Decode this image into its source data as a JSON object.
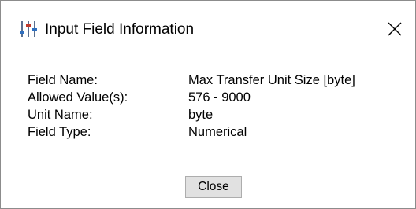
{
  "window": {
    "title": "Input Field Information",
    "icon": "sliders-icon",
    "close_icon": "close-icon"
  },
  "fields": [
    {
      "label": "Field Name:",
      "value": "Max Transfer Unit Size [byte]"
    },
    {
      "label": "Allowed Value(s):",
      "value": "576 - 9000"
    },
    {
      "label": "Unit Name:",
      "value": "byte"
    },
    {
      "label": "Field Type:",
      "value": "Numerical"
    }
  ],
  "footer": {
    "close_label": "Close"
  }
}
